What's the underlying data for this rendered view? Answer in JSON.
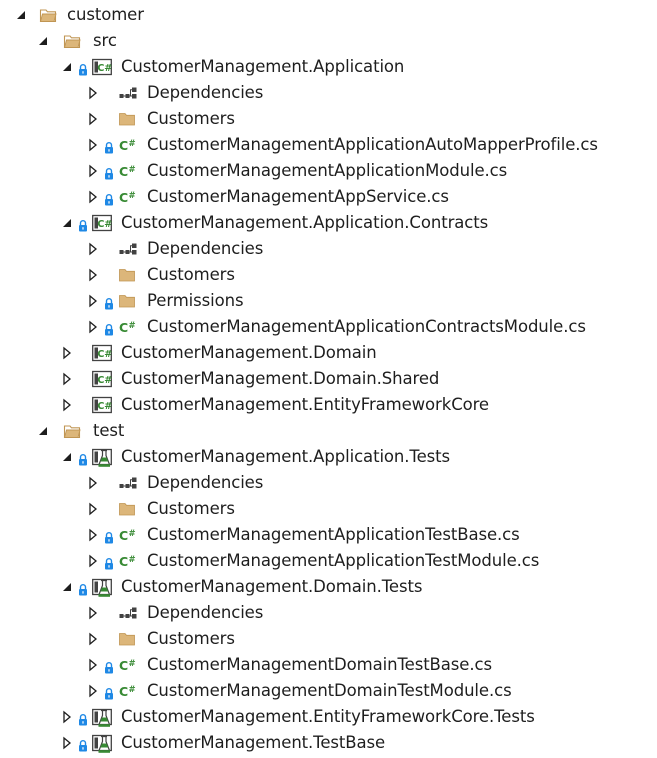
{
  "solution_explorer": {
    "nodes": [
      {
        "label": "customer",
        "kind": "folder-open",
        "level": 0,
        "expanded": true,
        "locked": false
      },
      {
        "label": "src",
        "kind": "folder-open",
        "level": 1,
        "expanded": true,
        "locked": false
      },
      {
        "label": "CustomerManagement.Application",
        "kind": "csproj",
        "level": 2,
        "expanded": true,
        "locked": true
      },
      {
        "label": "Dependencies",
        "kind": "dependencies",
        "level": 3,
        "expanded": false,
        "locked": false
      },
      {
        "label": "Customers",
        "kind": "folder",
        "level": 3,
        "expanded": false,
        "locked": false
      },
      {
        "label": "CustomerManagementApplicationAutoMapperProfile.cs",
        "kind": "csfile",
        "level": 3,
        "expanded": false,
        "locked": true
      },
      {
        "label": "CustomerManagementApplicationModule.cs",
        "kind": "csfile",
        "level": 3,
        "expanded": false,
        "locked": true
      },
      {
        "label": "CustomerManagementAppService.cs",
        "kind": "csfile",
        "level": 3,
        "expanded": false,
        "locked": true
      },
      {
        "label": "CustomerManagement.Application.Contracts",
        "kind": "csproj",
        "level": 2,
        "expanded": true,
        "locked": true
      },
      {
        "label": "Dependencies",
        "kind": "dependencies",
        "level": 3,
        "expanded": false,
        "locked": false
      },
      {
        "label": "Customers",
        "kind": "folder",
        "level": 3,
        "expanded": false,
        "locked": false
      },
      {
        "label": "Permissions",
        "kind": "folder",
        "level": 3,
        "expanded": false,
        "locked": true
      },
      {
        "label": "CustomerManagementApplicationContractsModule.cs",
        "kind": "csfile",
        "level": 3,
        "expanded": false,
        "locked": true
      },
      {
        "label": "CustomerManagement.Domain",
        "kind": "csproj",
        "level": 2,
        "expanded": false,
        "locked": false
      },
      {
        "label": "CustomerManagement.Domain.Shared",
        "kind": "csproj",
        "level": 2,
        "expanded": false,
        "locked": false
      },
      {
        "label": "CustomerManagement.EntityFrameworkCore",
        "kind": "csproj",
        "level": 2,
        "expanded": false,
        "locked": false
      },
      {
        "label": "test",
        "kind": "folder-open",
        "level": 1,
        "expanded": true,
        "locked": false
      },
      {
        "label": "CustomerManagement.Application.Tests",
        "kind": "testproj",
        "level": 2,
        "expanded": true,
        "locked": true
      },
      {
        "label": "Dependencies",
        "kind": "dependencies",
        "level": 3,
        "expanded": false,
        "locked": false
      },
      {
        "label": "Customers",
        "kind": "folder",
        "level": 3,
        "expanded": false,
        "locked": false
      },
      {
        "label": "CustomerManagementApplicationTestBase.cs",
        "kind": "csfile",
        "level": 3,
        "expanded": false,
        "locked": true
      },
      {
        "label": "CustomerManagementApplicationTestModule.cs",
        "kind": "csfile",
        "level": 3,
        "expanded": false,
        "locked": true
      },
      {
        "label": "CustomerManagement.Domain.Tests",
        "kind": "testproj",
        "level": 2,
        "expanded": true,
        "locked": true
      },
      {
        "label": "Dependencies",
        "kind": "dependencies",
        "level": 3,
        "expanded": false,
        "locked": false
      },
      {
        "label": "Customers",
        "kind": "folder",
        "level": 3,
        "expanded": false,
        "locked": false
      },
      {
        "label": "CustomerManagementDomainTestBase.cs",
        "kind": "csfile",
        "level": 3,
        "expanded": false,
        "locked": true
      },
      {
        "label": "CustomerManagementDomainTestModule.cs",
        "kind": "csfile",
        "level": 3,
        "expanded": false,
        "locked": true
      },
      {
        "label": "CustomerManagement.EntityFrameworkCore.Tests",
        "kind": "testproj",
        "level": 2,
        "expanded": false,
        "locked": true
      },
      {
        "label": "CustomerManagement.TestBase",
        "kind": "testproj",
        "level": 2,
        "expanded": false,
        "locked": true
      }
    ]
  },
  "icon_names": {
    "folder-open": "open-folder-icon",
    "folder": "folder-icon",
    "csproj": "csharp-project-icon",
    "testproj": "test-project-icon",
    "dependencies": "dependencies-icon",
    "csfile": "csharp-file-icon"
  },
  "colors": {
    "folder": "#dcb67a",
    "folder_dark": "#c09553",
    "csharp": "#388a34",
    "lock": "#1e88e5",
    "chevron": "#1e1e1e",
    "test_flask": "#388a34"
  }
}
